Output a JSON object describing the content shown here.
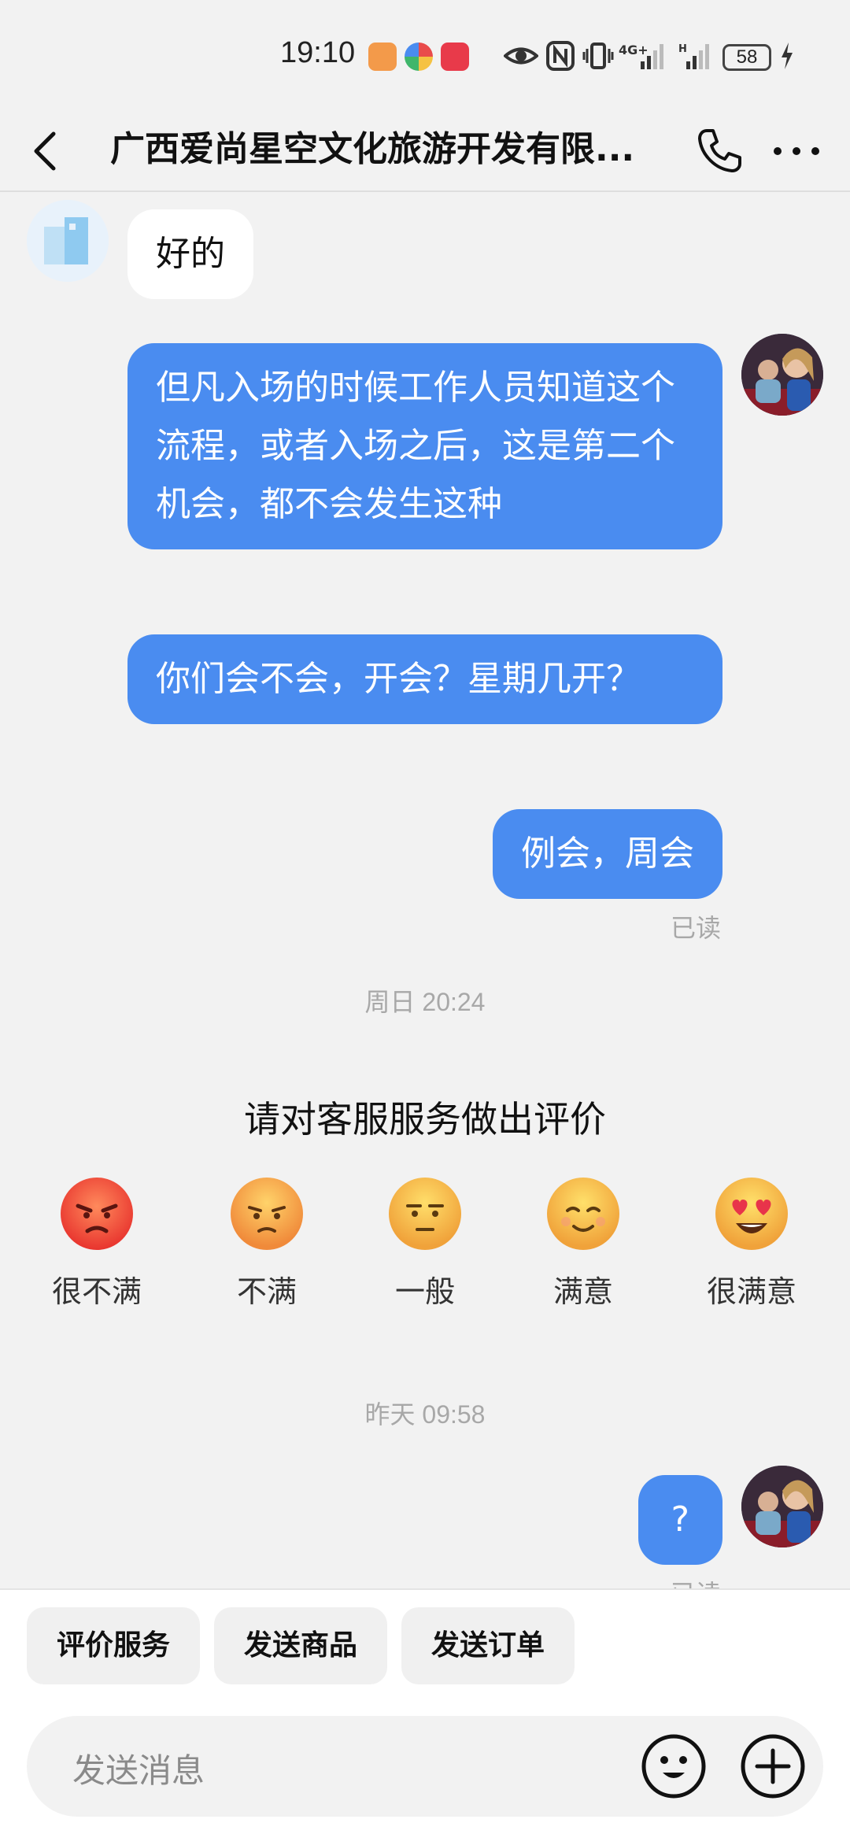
{
  "status_bar": {
    "time": "19:10",
    "network": "4G+",
    "battery": "58"
  },
  "header": {
    "title": "广西爱尚星空文化旅游开发有限..."
  },
  "messages": [
    {
      "direction": "in",
      "text": "好的"
    },
    {
      "direction": "out",
      "text": "但凡入场的时候工作人员知道这个流程，或者入场之后，这是第二个机会，都不会发生这种"
    },
    {
      "direction": "out",
      "text": "你们会不会，开会？星期几开？"
    },
    {
      "direction": "out",
      "text": "例会，周会"
    },
    {
      "direction": "out",
      "text": "?"
    }
  ],
  "read_status": "已读",
  "timestamps": {
    "first": "周日 20:24",
    "second": "昨天 09:58"
  },
  "rating": {
    "title": "请对客服服务做出评价",
    "options": [
      {
        "label": "很不满",
        "icon": "angry-face-icon"
      },
      {
        "label": "不满",
        "icon": "frowning-face-icon"
      },
      {
        "label": "一般",
        "icon": "neutral-face-icon"
      },
      {
        "label": "满意",
        "icon": "smiling-face-icon"
      },
      {
        "label": "很满意",
        "icon": "heart-eyes-face-icon"
      }
    ]
  },
  "quick_actions": [
    "评价服务",
    "发送商品",
    "发送订单"
  ],
  "input": {
    "placeholder": "发送消息"
  },
  "colors": {
    "outgoing_bubble": "#4a8cf0",
    "incoming_bubble": "#ffffff",
    "background": "#f2f2f2"
  }
}
